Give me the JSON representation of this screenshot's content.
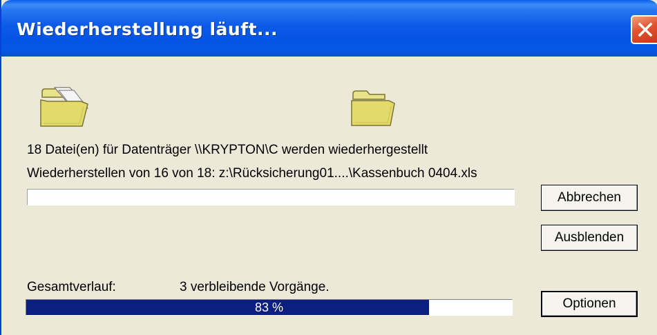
{
  "window": {
    "title": "Wiederherstellung läuft..."
  },
  "icons": {
    "source": "folder-with-documents-icon",
    "destination": "folder-icon"
  },
  "status": {
    "line1": "18 Datei(en) für Datenträger \\\\KRYPTON\\C werden wiederhergestellt",
    "line2": "Wiederherstellen von 16 von 18: z:\\Rücksicherung01....\\Kassenbuch 0404.xls"
  },
  "current_progress": {
    "percent": 0
  },
  "total": {
    "label": "Gesamtverlauf:",
    "remaining": "3 verbleibende Vorgänge.",
    "percent": 83,
    "percent_text": "83 %"
  },
  "buttons": {
    "cancel": "Abbrechen",
    "hide": "Ausblenden",
    "options": "Optionen"
  },
  "colors": {
    "title_bar": "#0554e3",
    "dialog_bg": "#ece9d8",
    "progress_fill": "#0a1f80",
    "close_button": "#e2532e"
  }
}
